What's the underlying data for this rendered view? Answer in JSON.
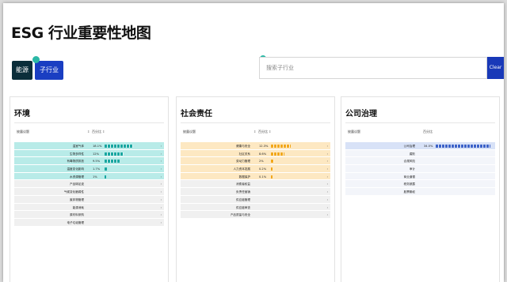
{
  "page": {
    "title": "ESG 行业重要性地图"
  },
  "filters": {
    "industry_button": "能源",
    "subindustry_button": "子行业"
  },
  "search": {
    "placeholder": "搜索子行业",
    "clear_label": "Clear"
  },
  "colors": {
    "env_bar": "#1aa7a1",
    "env_highlight": "#b8ebe8",
    "soc_bar": "#f2a81d",
    "soc_highlight": "#fde8c2",
    "gov_bar": "#3d63c9",
    "gov_highlight": "#d8e2f7"
  },
  "panels": [
    {
      "title": "环境",
      "header_name": "披露议题",
      "header_metric": "百分比",
      "rows": [
        {
          "name": "温室气体",
          "pct": "18.1%",
          "fill": 0.181,
          "active": true
        },
        {
          "name": "生物多样性",
          "pct": "12%",
          "fill": 0.12,
          "active": true
        },
        {
          "name": "有毒物质排放",
          "pct": "9.5%",
          "fill": 0.095,
          "active": true
        },
        {
          "name": "温度变化影响",
          "pct": "1.7%",
          "fill": 0.017,
          "active": true
        },
        {
          "name": "水资源管理",
          "pct": "1%",
          "fill": 0.01,
          "active": true
        },
        {
          "name": "产品碳足迹",
          "pct": "",
          "fill": 0,
          "active": false
        },
        {
          "name": "气候变化脆弱性",
          "pct": "",
          "fill": 0,
          "active": false
        },
        {
          "name": "废弃物管理",
          "pct": "",
          "fill": 0,
          "active": false
        },
        {
          "name": "能源消耗",
          "pct": "",
          "fill": 0,
          "active": false
        },
        {
          "name": "原材料采购",
          "pct": "",
          "fill": 0,
          "active": false
        },
        {
          "name": "电子垃圾管理",
          "pct": "",
          "fill": 0,
          "active": false
        }
      ]
    },
    {
      "title": "社会责任",
      "header_name": "披露议题",
      "header_metric": "百分比",
      "rows": [
        {
          "name": "健康与安全",
          "pct": "12.3%",
          "fill": 0.123,
          "active": true
        },
        {
          "name": "社区关系",
          "pct": "8.6%",
          "fill": 0.086,
          "active": true
        },
        {
          "name": "劳动力管理",
          "pct": "2%",
          "fill": 0.02,
          "active": true
        },
        {
          "name": "人力资本发展",
          "pct": "0.2%",
          "fill": 0.002,
          "active": true
        },
        {
          "name": "数据保护",
          "pct": "0.1%",
          "fill": 0.001,
          "active": true
        },
        {
          "name": "消费者权益",
          "pct": "",
          "fill": 0,
          "active": false
        },
        {
          "name": "负责任营销",
          "pct": "",
          "fill": 0,
          "active": false
        },
        {
          "name": "供应链管理",
          "pct": "",
          "fill": 0,
          "active": false
        },
        {
          "name": "供应链审查",
          "pct": "",
          "fill": 0,
          "active": false
        },
        {
          "name": "产品质量与安全",
          "pct": "",
          "fill": 0,
          "active": false
        }
      ]
    },
    {
      "title": "公司治理",
      "header_name": "披露议题",
      "header_metric": "百分比",
      "rows": [
        {
          "name": "公司治理",
          "pct": "34.5%",
          "fill": 0.345,
          "active": true
        },
        {
          "name": "腐败",
          "pct": "",
          "fill": 0,
          "active": false
        },
        {
          "name": "合规风险",
          "pct": "",
          "fill": 0,
          "active": false
        },
        {
          "name": "审计",
          "pct": "",
          "fill": 0,
          "active": false
        },
        {
          "name": "商业道德",
          "pct": "",
          "fill": 0,
          "active": false
        },
        {
          "name": "税务披露",
          "pct": "",
          "fill": 0,
          "active": false
        },
        {
          "name": "股票期权",
          "pct": "",
          "fill": 0,
          "active": false
        }
      ]
    }
  ]
}
